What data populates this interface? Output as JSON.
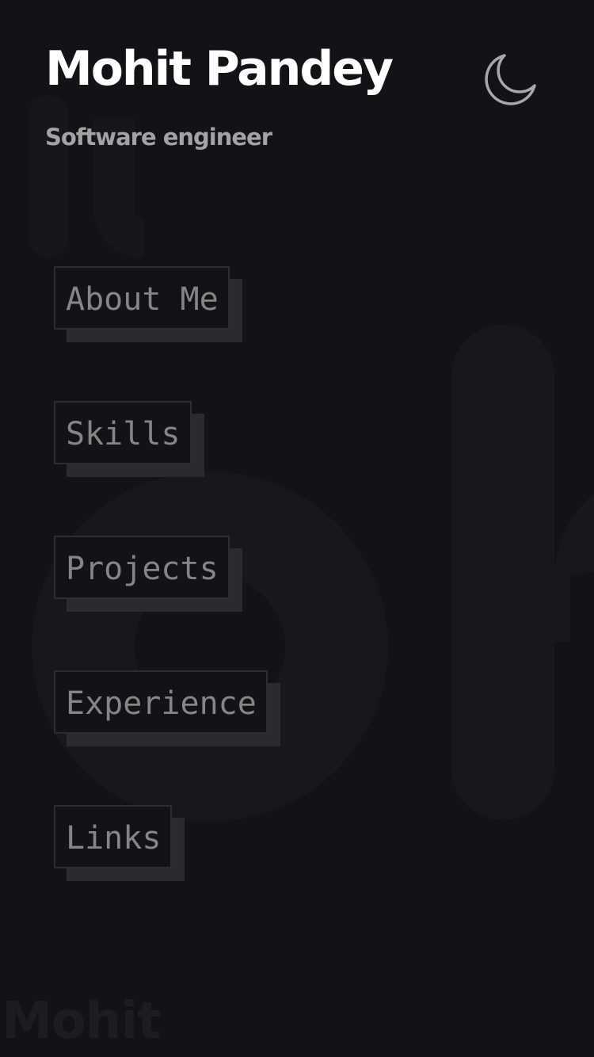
{
  "header": {
    "title": "Mohit Pandey",
    "subtitle": "Software engineer"
  },
  "theme_toggle": {
    "icon": "moon-icon",
    "mode": "dark"
  },
  "nav": {
    "items": [
      {
        "label": "About Me"
      },
      {
        "label": "Skills"
      },
      {
        "label": "Projects"
      },
      {
        "label": "Experience"
      },
      {
        "label": "Links"
      }
    ]
  },
  "background": {
    "footer_word": "Mohit"
  },
  "colors": {
    "background": "#111317",
    "title": "#ffffff",
    "subtitle": "#a3a3a3",
    "nav_text": "#858585",
    "nav_border": "#2b2d30",
    "nav_shadow": "#292b2e",
    "icon": "#a8a8a8"
  }
}
